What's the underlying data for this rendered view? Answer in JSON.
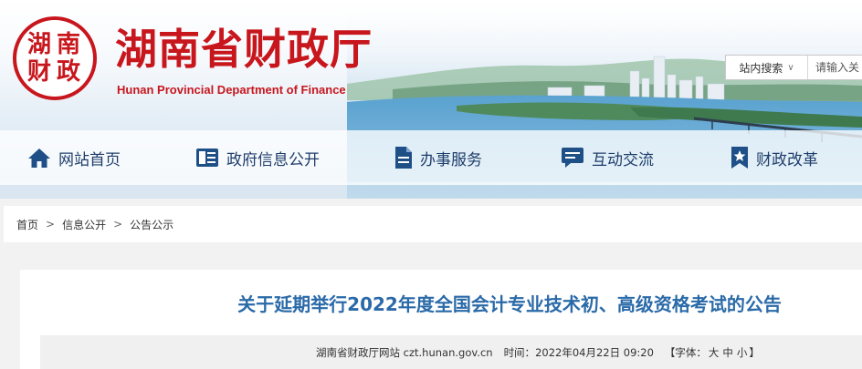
{
  "site": {
    "title": "湖南省财政厅",
    "subtitle": "Hunan Provincial Department of Finance",
    "seal_chars": [
      "湖",
      "南",
      "财",
      "政"
    ],
    "brand_color": "#c8161d"
  },
  "search": {
    "scope_label": "站内搜索",
    "placeholder": "请输入关"
  },
  "nav": {
    "items": [
      {
        "label": "网站首页",
        "icon": "home-icon"
      },
      {
        "label": "政府信息公开",
        "icon": "newspaper-icon"
      },
      {
        "label": "办事服务",
        "icon": "document-icon"
      },
      {
        "label": "互动交流",
        "icon": "chat-icon"
      },
      {
        "label": "财政改革",
        "icon": "bookmark-star-icon"
      }
    ],
    "text_color": "#1e3d6b"
  },
  "breadcrumb": {
    "items": [
      "首页",
      "信息公开",
      "公告公示"
    ],
    "separator": ">"
  },
  "article": {
    "title": "关于延期举行2022年度全国会计专业技术初、高级资格考试的公告",
    "title_color": "#2a6aa8",
    "source": "湖南省财政厅网站 czt.hunan.gov.cn",
    "time_label": "时间：",
    "time_value": "2022年04月22日 09:20",
    "font_open": "【字体：",
    "font_sizes": [
      "大",
      "中",
      "小"
    ],
    "font_close": "】"
  }
}
